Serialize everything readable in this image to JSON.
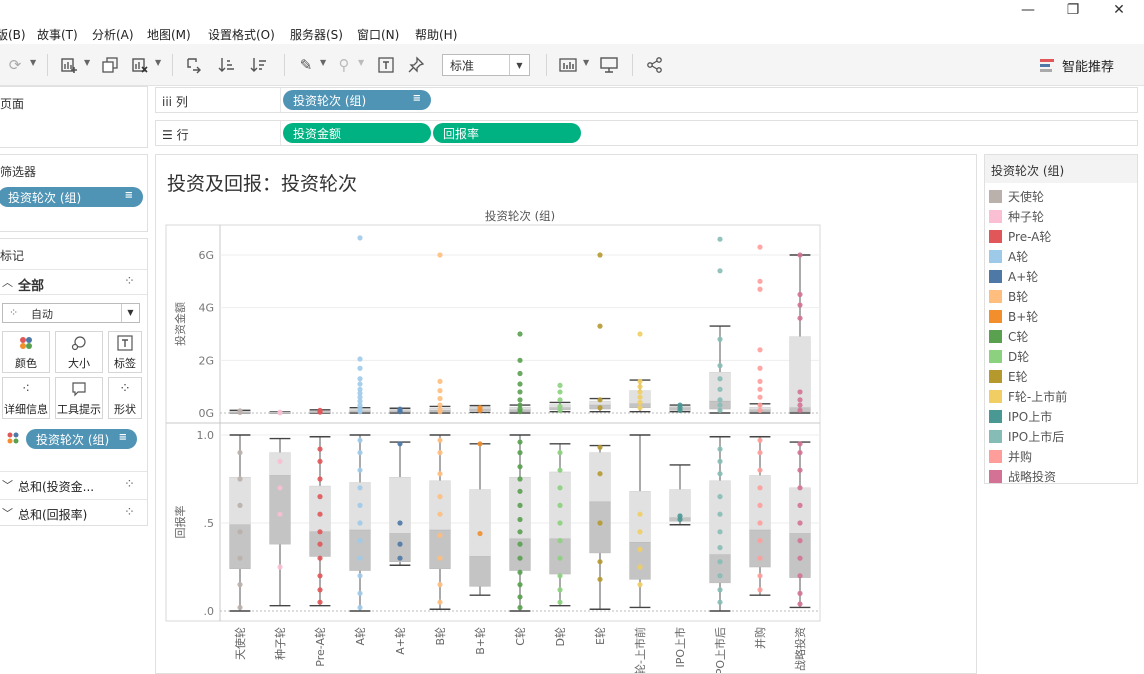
{
  "menu": {
    "items": [
      "版(B)",
      "故事(T)",
      "分析(A)",
      "地图(M)",
      "设置格式(O)",
      "服务器(S)",
      "窗口(N)",
      "帮助(H)"
    ]
  },
  "window_controls": {
    "minimize": "—",
    "restore": "❐",
    "close": "✕"
  },
  "toolbar": {
    "fit_value": "标准",
    "show_me_label": "智能推荐"
  },
  "left": {
    "pages_title": "页面",
    "filters_title": "筛选器",
    "filter_pill": "投资轮次 (组)",
    "marks_title": "标记",
    "marks_all": "全部",
    "mark_type": "自动",
    "mark_cells": [
      "颜色",
      "大小",
      "标签",
      "详细信息",
      "工具提示",
      "形状"
    ],
    "color_pill": "投资轮次 (组)",
    "sum_items": [
      "总和(投资金...",
      "总和(回报率)"
    ]
  },
  "shelves": {
    "columns_label": "列",
    "rows_label": "行",
    "columns_pill": "投资轮次 (组)",
    "rows_pills": [
      "投资金额",
      "回报率"
    ]
  },
  "sheet_title": "投资及回报：投资轮次",
  "legend": {
    "title": "投资轮次 (组)",
    "items": [
      {
        "label": "天使轮",
        "color": "#bab0ac"
      },
      {
        "label": "种子轮",
        "color": "#fabfd2"
      },
      {
        "label": "Pre-A轮",
        "color": "#e15759"
      },
      {
        "label": "A轮",
        "color": "#9ecae9"
      },
      {
        "label": "A+轮",
        "color": "#4e79a7"
      },
      {
        "label": "B轮",
        "color": "#ffbe7d"
      },
      {
        "label": "B+轮",
        "color": "#f28e2b"
      },
      {
        "label": "C轮",
        "color": "#59a14f"
      },
      {
        "label": "D轮",
        "color": "#8cd17d"
      },
      {
        "label": "E轮",
        "color": "#b6992d"
      },
      {
        "label": "F轮-上市前",
        "color": "#f1ce63"
      },
      {
        "label": "IPO上市",
        "color": "#499894"
      },
      {
        "label": "IPO上市后",
        "color": "#86bcb6"
      },
      {
        "label": "并购",
        "color": "#ff9d9a"
      },
      {
        "label": "战略投资",
        "color": "#d37295"
      }
    ]
  },
  "chart_data": {
    "type": "scatter",
    "subtype": "box-and-whisker, two panes",
    "header": "投资轮次 (组)",
    "categories": [
      "天使轮",
      "种子轮",
      "Pre-A轮",
      "A轮",
      "A+轮",
      "B轮",
      "B+轮",
      "C轮",
      "D轮",
      "E轮",
      "F轮-上市前",
      "IPO上市",
      "IPO上市后",
      "并购",
      "战略投资"
    ],
    "category_colors": [
      "#bab0ac",
      "#fabfd2",
      "#e15759",
      "#9ecae9",
      "#4e79a7",
      "#ffbe7d",
      "#f28e2b",
      "#59a14f",
      "#8cd17d",
      "#b6992d",
      "#f1ce63",
      "#499894",
      "#86bcb6",
      "#ff9d9a",
      "#d37295"
    ],
    "panes": [
      {
        "measure": "投资金额",
        "ylabel": "投资金额",
        "ylim": [
          0,
          7
        ],
        "unit": "G",
        "ticks": [
          0,
          2,
          4,
          6
        ],
        "tick_labels": [
          "0G",
          "2G",
          "4G",
          "6G"
        ],
        "boxes": [
          {
            "min": 0,
            "q1": 0.01,
            "median": 0.03,
            "q3": 0.06,
            "max": 0.1
          },
          {
            "min": 0,
            "q1": 0.01,
            "median": 0.02,
            "q3": 0.04,
            "max": 0.05
          },
          {
            "min": 0,
            "q1": 0.02,
            "median": 0.05,
            "q3": 0.08,
            "max": 0.12
          },
          {
            "min": 0,
            "q1": 0.03,
            "median": 0.08,
            "q3": 0.15,
            "max": 0.2
          },
          {
            "min": 0,
            "q1": 0.03,
            "median": 0.08,
            "q3": 0.14,
            "max": 0.18
          },
          {
            "min": 0,
            "q1": 0.04,
            "median": 0.1,
            "q3": 0.18,
            "max": 0.25
          },
          {
            "min": 0.02,
            "q1": 0.08,
            "median": 0.15,
            "q3": 0.22,
            "max": 0.28
          },
          {
            "min": 0,
            "q1": 0.05,
            "median": 0.12,
            "q3": 0.22,
            "max": 0.3
          },
          {
            "min": 0.05,
            "q1": 0.12,
            "median": 0.2,
            "q3": 0.32,
            "max": 0.4
          },
          {
            "min": 0.05,
            "q1": 0.15,
            "median": 0.3,
            "q3": 0.45,
            "max": 0.55
          },
          {
            "min": 0.05,
            "q1": 0.2,
            "median": 0.35,
            "q3": 0.85,
            "max": 1.25
          },
          {
            "min": 0.05,
            "q1": 0.1,
            "median": 0.2,
            "q3": 0.25,
            "max": 0.3
          },
          {
            "min": 0,
            "q1": 0.15,
            "median": 0.45,
            "q3": 1.55,
            "max": 3.3
          },
          {
            "min": 0,
            "q1": 0.05,
            "median": 0.12,
            "q3": 0.22,
            "max": 0.35
          },
          {
            "min": 0,
            "q1": 0.05,
            "median": 0.2,
            "q3": 2.9,
            "max": 6.0
          }
        ],
        "points": [
          [
            0.02,
            0.05,
            0.08
          ],
          [
            0.01,
            0.03
          ],
          [
            0.03,
            0.06,
            0.1
          ],
          [
            0.05,
            0.1,
            0.2,
            0.3,
            0.45,
            0.6,
            0.75,
            0.9,
            1.1,
            1.3,
            1.7,
            2.05,
            6.65
          ],
          [
            0.05,
            0.1,
            0.15
          ],
          [
            0.05,
            0.12,
            0.3,
            0.55,
            0.85,
            1.2,
            6.0
          ],
          [
            0.1,
            0.2
          ],
          [
            0.05,
            0.15,
            0.3,
            0.5,
            0.8,
            1.1,
            1.5,
            2.0,
            3.0
          ],
          [
            0.1,
            0.25,
            0.5,
            0.8,
            1.05
          ],
          [
            0.2,
            0.5,
            3.3,
            6.0
          ],
          [
            0.2,
            0.4,
            0.6,
            0.8,
            1.0,
            1.2,
            3.0
          ],
          [
            0.1,
            0.2,
            0.3
          ],
          [
            0.1,
            0.3,
            0.5,
            0.9,
            1.3,
            1.8,
            2.8,
            5.4,
            6.6
          ],
          [
            0.1,
            0.3,
            0.6,
            0.9,
            1.2,
            1.7,
            2.4,
            4.7,
            5.0,
            6.3
          ],
          [
            0.1,
            0.3,
            0.5,
            0.8,
            3.6,
            4.1,
            4.5,
            6.0
          ]
        ]
      },
      {
        "measure": "回报率",
        "ylabel": "回报率",
        "ylim": [
          -0.05,
          1.05
        ],
        "ticks": [
          0,
          0.5,
          1.0
        ],
        "tick_labels": [
          ".0",
          ".5",
          "1.0"
        ],
        "boxes": [
          {
            "min": 0.0,
            "q1": 0.24,
            "median": 0.49,
            "q3": 0.76,
            "max": 1.0
          },
          {
            "min": 0.03,
            "q1": 0.38,
            "median": 0.77,
            "q3": 0.9,
            "max": 0.98
          },
          {
            "min": 0.03,
            "q1": 0.31,
            "median": 0.45,
            "q3": 0.71,
            "max": 0.99
          },
          {
            "min": 0.0,
            "q1": 0.23,
            "median": 0.46,
            "q3": 0.73,
            "max": 1.0
          },
          {
            "min": 0.26,
            "q1": 0.28,
            "median": 0.44,
            "q3": 0.76,
            "max": 0.96
          },
          {
            "min": 0.01,
            "q1": 0.24,
            "median": 0.46,
            "q3": 0.74,
            "max": 1.0
          },
          {
            "min": 0.09,
            "q1": 0.14,
            "median": 0.31,
            "q3": 0.69,
            "max": 0.95
          },
          {
            "min": 0.0,
            "q1": 0.23,
            "median": 0.41,
            "q3": 0.76,
            "max": 1.0
          },
          {
            "min": 0.03,
            "q1": 0.21,
            "median": 0.41,
            "q3": 0.79,
            "max": 0.95
          },
          {
            "min": 0.01,
            "q1": 0.33,
            "median": 0.62,
            "q3": 0.9,
            "max": 0.94
          },
          {
            "min": 0.02,
            "q1": 0.18,
            "median": 0.39,
            "q3": 0.68,
            "max": 1.0
          },
          {
            "min": 0.49,
            "q1": 0.51,
            "median": 0.53,
            "q3": 0.69,
            "max": 0.83
          },
          {
            "min": 0.0,
            "q1": 0.16,
            "median": 0.32,
            "q3": 0.74,
            "max": 0.99
          },
          {
            "min": 0.09,
            "q1": 0.25,
            "median": 0.46,
            "q3": 0.77,
            "max": 0.99
          },
          {
            "min": 0.02,
            "q1": 0.19,
            "median": 0.44,
            "q3": 0.7,
            "max": 0.96
          }
        ],
        "points": [
          [
            0.02,
            0.15,
            0.3,
            0.45,
            0.6,
            0.75,
            0.9
          ],
          [
            0.25,
            0.55,
            0.7,
            0.85
          ],
          [
            0.05,
            0.12,
            0.2,
            0.3,
            0.38,
            0.45,
            0.55,
            0.65,
            0.75,
            0.85,
            0.92
          ],
          [
            0.02,
            0.1,
            0.2,
            0.3,
            0.4,
            0.5,
            0.6,
            0.7,
            0.8,
            0.9,
            0.97
          ],
          [
            0.3,
            0.38,
            0.5,
            0.95
          ],
          [
            0.05,
            0.15,
            0.3,
            0.43,
            0.55,
            0.65,
            0.78,
            0.9,
            0.97
          ],
          [
            0.44,
            0.95
          ],
          [
            0.02,
            0.08,
            0.15,
            0.22,
            0.3,
            0.38,
            0.45,
            0.52,
            0.6,
            0.68,
            0.75,
            0.82,
            0.9,
            0.96
          ],
          [
            0.05,
            0.12,
            0.2,
            0.3,
            0.4,
            0.5,
            0.6,
            0.7,
            0.8,
            0.9
          ],
          [
            0.18,
            0.28,
            0.5,
            0.78,
            0.93
          ],
          [
            0.15,
            0.25,
            0.35,
            0.45,
            0.55
          ],
          [
            0.52,
            0.54
          ],
          [
            0.05,
            0.12,
            0.2,
            0.28,
            0.36,
            0.45,
            0.55,
            0.65,
            0.78,
            0.85,
            0.92
          ],
          [
            0.12,
            0.2,
            0.3,
            0.4,
            0.5,
            0.6,
            0.7,
            0.8,
            0.9,
            0.97
          ],
          [
            0.04,
            0.1,
            0.2,
            0.3,
            0.4,
            0.5,
            0.6,
            0.7,
            0.8,
            0.9,
            0.95
          ]
        ]
      }
    ],
    "grid": true,
    "legend_position": "right"
  }
}
